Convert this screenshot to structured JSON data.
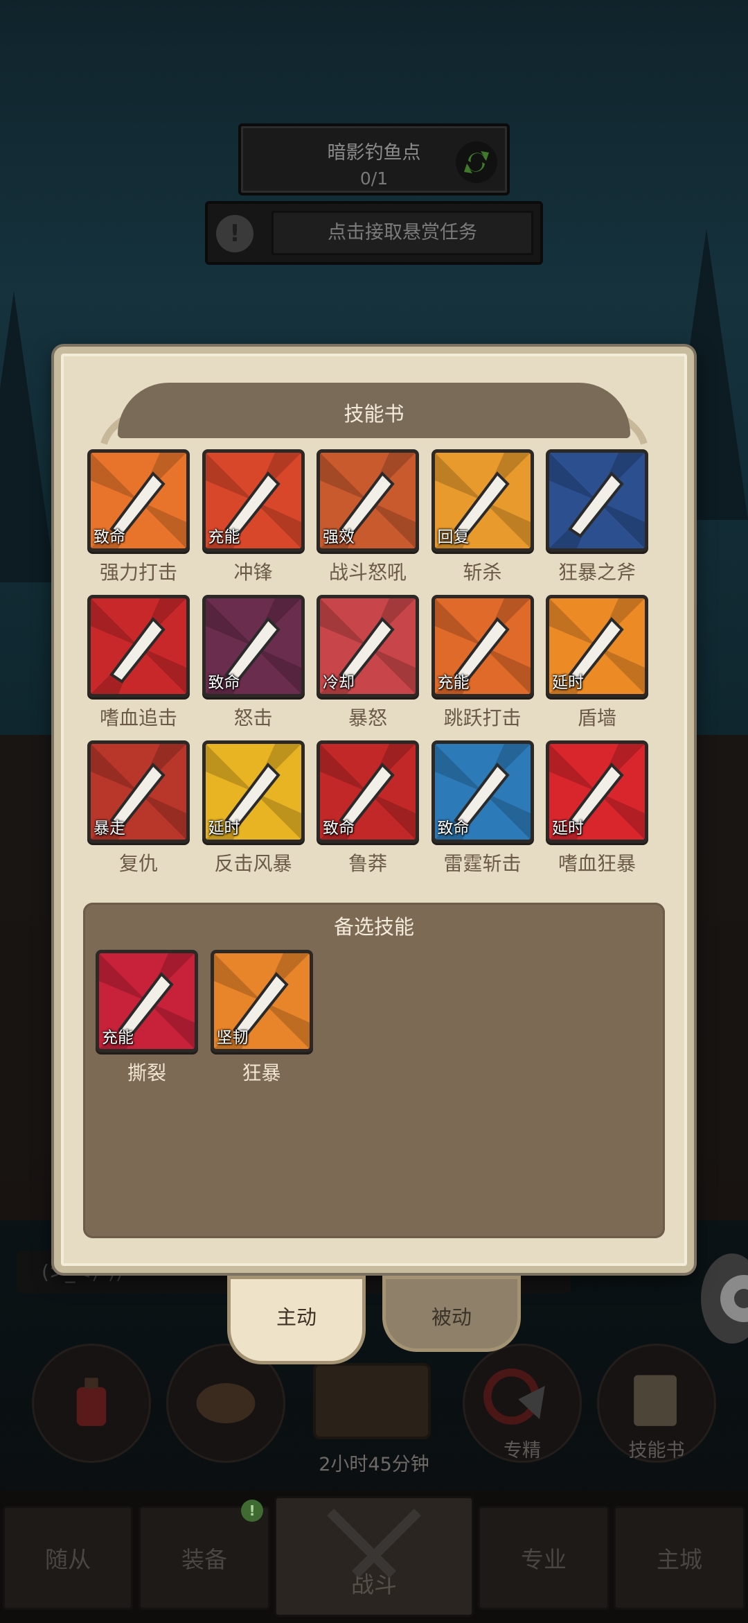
{
  "quest": {
    "title": "暗影钓鱼点",
    "progress": "0/1",
    "refresh_icon": "refresh-arrows-icon"
  },
  "bounty": {
    "alert_icon": "exclamation-icon",
    "label": "点击接取悬赏任务"
  },
  "panel": {
    "title": "技能书",
    "reserve_title": "备选技能"
  },
  "skills": [
    {
      "name": "强力打击",
      "tag": "致命",
      "icon": "blade-icon",
      "color": "#e8742c"
    },
    {
      "name": "冲锋",
      "tag": "充能",
      "icon": "charge-arrow-icon",
      "color": "#d9472a"
    },
    {
      "name": "战斗怒吼",
      "tag": "强效",
      "icon": "lightning-shout-icon",
      "color": "#c95a2e"
    },
    {
      "name": "斩杀",
      "tag": "回复",
      "icon": "execute-sword-icon",
      "color": "#e89a2c"
    },
    {
      "name": "狂暴之斧",
      "tag": "",
      "icon": "lightning-axe-icon",
      "color": "#2b4f8f"
    },
    {
      "name": "嗜血追击",
      "tag": "",
      "icon": "fist-icon",
      "color": "#c8282a"
    },
    {
      "name": "怒击",
      "tag": "致命",
      "icon": "spiked-mace-icon",
      "color": "#6b2d4d"
    },
    {
      "name": "暴怒",
      "tag": "冷却",
      "icon": "rage-face-icon",
      "color": "#c8464a"
    },
    {
      "name": "跳跃打击",
      "tag": "充能",
      "icon": "leap-strike-icon",
      "color": "#e06a2a"
    },
    {
      "name": "盾墙",
      "tag": "延时",
      "icon": "shield-wall-icon",
      "color": "#ec8a26"
    },
    {
      "name": "复仇",
      "tag": "暴走",
      "icon": "revenge-sword-icon",
      "color": "#b8362a"
    },
    {
      "name": "反击风暴",
      "tag": "延时",
      "icon": "counter-storm-icon",
      "color": "#e8b424"
    },
    {
      "name": "鲁莽",
      "tag": "致命",
      "icon": "reckless-fist-icon",
      "color": "#c22828"
    },
    {
      "name": "雷霆斩击",
      "tag": "致命",
      "icon": "thunder-slash-icon",
      "color": "#2c7ab8"
    },
    {
      "name": "嗜血狂暴",
      "tag": "延时",
      "icon": "blood-mask-icon",
      "color": "#d8262c"
    }
  ],
  "reserve_skills": [
    {
      "name": "撕裂",
      "tag": "充能",
      "icon": "rend-claw-icon",
      "color": "#c8223a"
    },
    {
      "name": "狂暴",
      "tag": "坚韧",
      "icon": "berserk-hood-icon",
      "color": "#e8842a"
    }
  ],
  "tabs": {
    "active": "主动",
    "passive": "被动"
  },
  "hud": {
    "chat_placeholder": "(>_<)\"))",
    "slots": [
      "",
      "",
      "",
      "专精",
      "技能书"
    ],
    "timer": "2小时45分钟",
    "gear_icon": "gear-icon"
  },
  "nav": {
    "items": [
      "随从",
      "装备",
      "战斗",
      "专业",
      "主城"
    ],
    "badge": "!"
  }
}
